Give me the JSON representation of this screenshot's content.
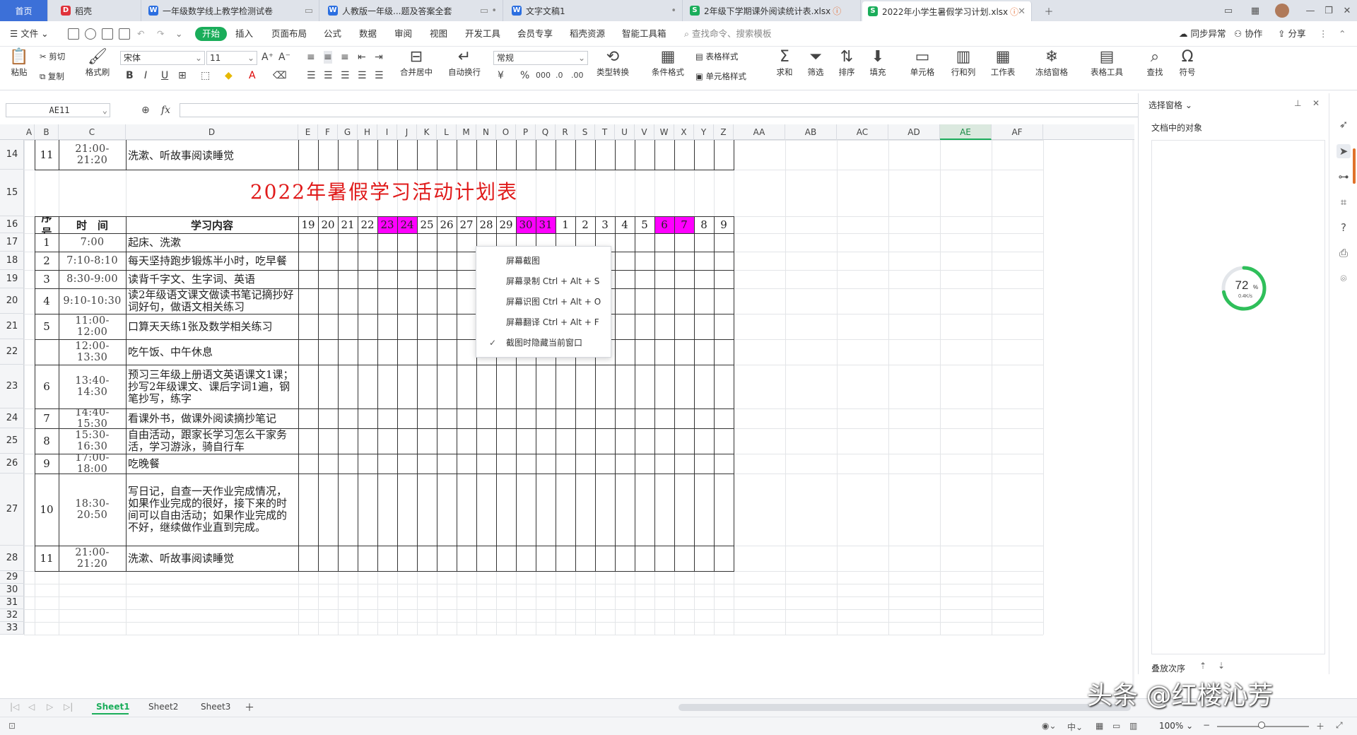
{
  "tabs": [
    {
      "label": "首页",
      "type": "home"
    },
    {
      "label": "稻壳",
      "icon": "docer"
    },
    {
      "label": "一年级数学线上教学检测试卷",
      "icon": "W"
    },
    {
      "label": "人教版一年级...题及答案全套",
      "icon": "W"
    },
    {
      "label": "文字文稿1",
      "icon": "W"
    },
    {
      "label": "2年级下学期课外阅读统计表.xlsx",
      "icon": "S"
    },
    {
      "label": "2022年小学生暑假学习计划.xlsx",
      "icon": "S",
      "active": true
    }
  ],
  "menu": {
    "file": "文件",
    "items": [
      "开始",
      "插入",
      "页面布局",
      "公式",
      "数据",
      "审阅",
      "视图",
      "开发工具",
      "会员专享",
      "稻壳资源",
      "智能工具箱"
    ],
    "search": "查找命令、搜索模板",
    "sync": "同步异常",
    "collab": "协作",
    "share": "分享"
  },
  "ribbon": {
    "paste": "粘贴",
    "cut": "剪切",
    "copy": "复制",
    "format_painter": "格式刷",
    "font_name": "宋体",
    "font_size": "11",
    "number_format": "常规",
    "merge": "合并居中",
    "wrap": "自动换行",
    "convert": "类型转换",
    "cond_format": "条件格式",
    "table_style": "表格样式",
    "cell_style": "单元格样式",
    "sum": "求和",
    "filter": "筛选",
    "sort": "排序",
    "fill": "填充",
    "cell": "单元格",
    "rowcol": "行和列",
    "sheet": "工作表",
    "freeze": "冻结窗格",
    "table_tools": "表格工具",
    "find": "查找",
    "symbol": "符号"
  },
  "formula": {
    "name_box": "AE11",
    "fx": "fx",
    "value": ""
  },
  "columns": [
    "A",
    "B",
    "C",
    "D",
    "E",
    "F",
    "G",
    "H",
    "I",
    "J",
    "K",
    "L",
    "M",
    "N",
    "O",
    "P",
    "Q",
    "R",
    "S",
    "T",
    "U",
    "V",
    "W",
    "X",
    "Y",
    "Z",
    "AA",
    "AB",
    "AC",
    "AD",
    "AE",
    "AF"
  ],
  "selected_column": "AE",
  "rows": [
    "14",
    "15",
    "16",
    "17",
    "18",
    "19",
    "20",
    "21",
    "22",
    "23",
    "24",
    "25",
    "26",
    "27",
    "28",
    "29",
    "30",
    "31",
    "32",
    "33"
  ],
  "sheet": {
    "row14": {
      "no": "11",
      "time": "21:00-21:20",
      "content": "洗漱、听故事阅读睡觉"
    },
    "title": "2022年暑假学习活动计划表",
    "header": {
      "no": "序号",
      "time": "时　间",
      "content": "学习内容"
    },
    "days": [
      "19",
      "20",
      "21",
      "22",
      "23",
      "24",
      "25",
      "26",
      "27",
      "28",
      "29",
      "30",
      "31",
      "1",
      "2",
      "3",
      "4",
      "5",
      "6",
      "7",
      "8",
      "9"
    ],
    "highlight_days": [
      "23",
      "24",
      "30",
      "31",
      "6",
      "7"
    ],
    "highlight_color": "#ff00ff",
    "title_color": "#e01b1b",
    "entries": [
      {
        "no": "1",
        "time": "7:00",
        "content": "起床、洗漱"
      },
      {
        "no": "2",
        "time": "7:10-8:10",
        "content": "每天坚持跑步锻炼半小时，吃早餐"
      },
      {
        "no": "3",
        "time": "8:30-9:00",
        "content": "读背千字文、生字词、英语"
      },
      {
        "no": "4",
        "time": "9:10-10:30",
        "content": "读2年级语文课文做读书笔记摘抄好词好句，做语文相关练习"
      },
      {
        "no": "5",
        "time": "11:00-12:00",
        "content": "口算天天练1张及数学相关练习"
      },
      {
        "no": "",
        "time": "12:00-13:30",
        "content": "吃午饭、中午休息"
      },
      {
        "no": "6",
        "time": "13:40-14:30",
        "content": "预习三年级上册语文英语课文1课；抄写2年级课文、课后字词1遍，钢笔抄写，练字"
      },
      {
        "no": "7",
        "time": "14:40-15:30",
        "content": "看课外书，做课外阅读摘抄笔记"
      },
      {
        "no": "8",
        "time": "15:30-16:30",
        "content": "自由活动，跟家长学习怎么干家务活，学习游泳，骑自行车"
      },
      {
        "no": "9",
        "time": "17:00-18:00",
        "content": "吃晚餐"
      },
      {
        "no": "10",
        "time": "18:30-20:50",
        "content": "写日记，自查一天作业完成情况，如果作业完成的很好，接下来的时间可以自由活动；如果作业完成的不好，继续做作业直到完成。"
      },
      {
        "no": "11",
        "time": "21:00-21:20",
        "content": "洗漱、听故事阅读睡觉"
      }
    ]
  },
  "context_menu": [
    {
      "label": "屏幕截图"
    },
    {
      "label": "屏幕录制 Ctrl + Alt + S"
    },
    {
      "label": "屏幕识图 Ctrl + Alt + O"
    },
    {
      "label": "屏幕翻译 Ctrl + Alt + F"
    },
    {
      "label": "截图时隐藏当前窗口",
      "checked": true
    }
  ],
  "pane": {
    "title": "选择窗格",
    "subtitle": "文档中的对象",
    "order": "叠放次序"
  },
  "gauge": {
    "percent": "72",
    "unit": "%",
    "speed": "0.4K/s",
    "value": 0.72
  },
  "sheets": [
    "Sheet1",
    "Sheet2",
    "Sheet3"
  ],
  "active_sheet": "Sheet1",
  "status": {
    "zoom": "100%",
    "lang": "中"
  },
  "watermark": "头条 @红楼沁芳"
}
